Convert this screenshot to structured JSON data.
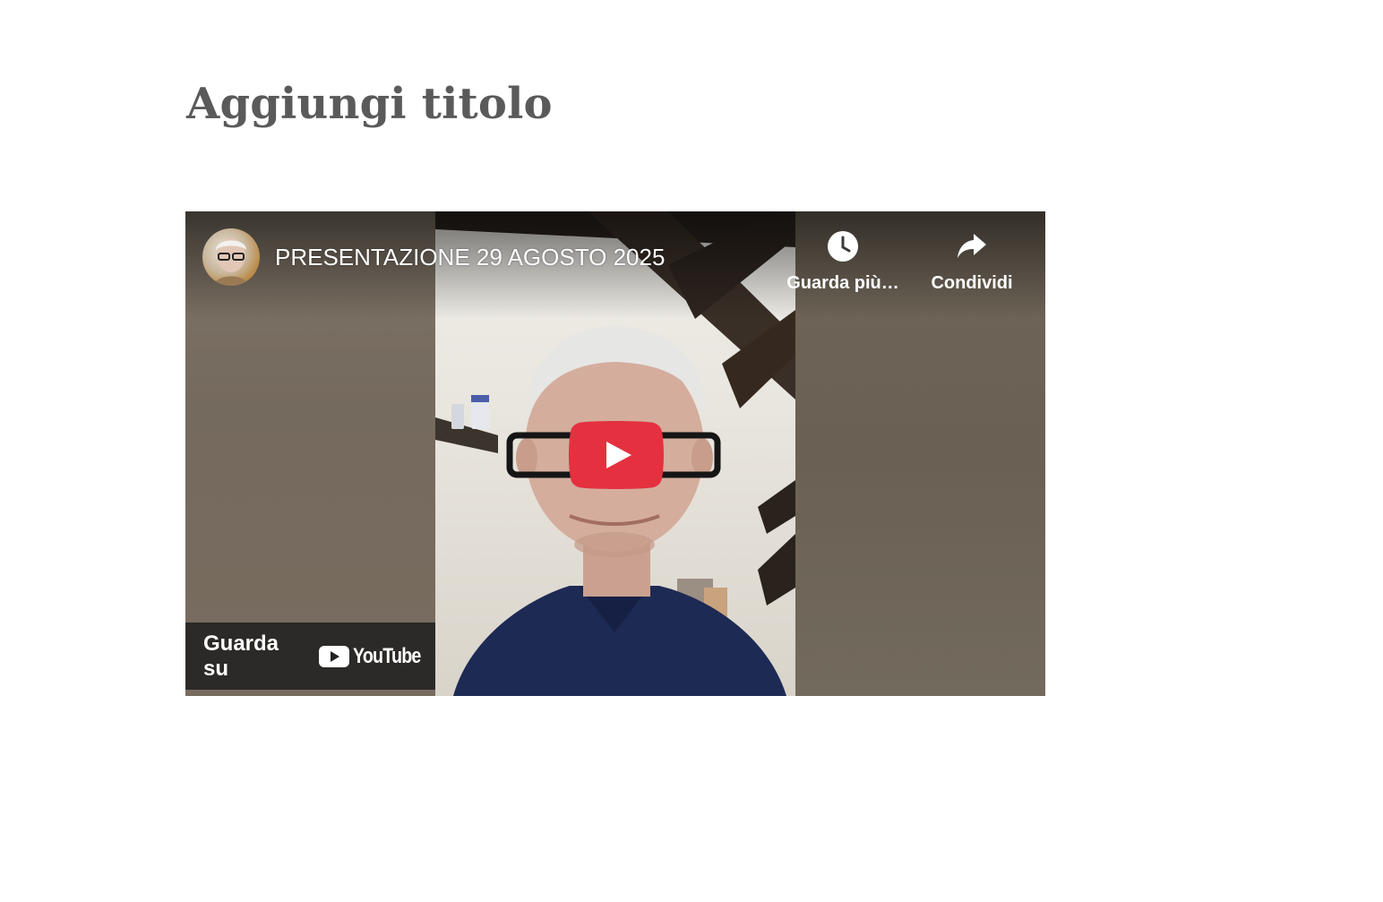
{
  "page": {
    "title": "Aggiungi titolo"
  },
  "video": {
    "title": "PRESENTAZIONE 29 AGOSTO 2025",
    "channel_avatar_icon": "channel-avatar",
    "actions": [
      {
        "label": "Guarda più…",
        "icon": "clock-icon"
      },
      {
        "label": "Condividi",
        "icon": "share-arrow-icon"
      }
    ],
    "play_icon": "play-icon",
    "watch_on": {
      "label": "Guarda su",
      "logo_text": "YouTube"
    },
    "colors": {
      "play_button": "#e5303f",
      "overlay": "#212121"
    }
  }
}
